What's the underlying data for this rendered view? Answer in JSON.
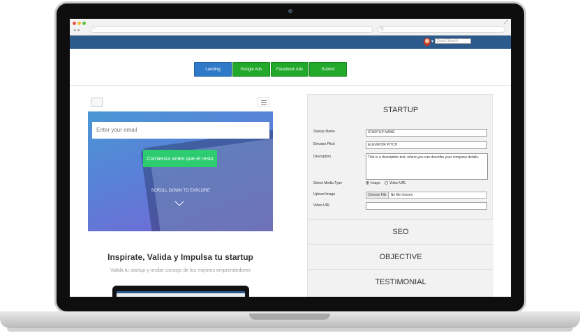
{
  "browser": {
    "address_placeholder": "+",
    "search_placeholder": "Q"
  },
  "appbar": {
    "quick_search_placeholder": "Quick Search"
  },
  "tabs": [
    {
      "label": "Landing"
    },
    {
      "label": "Google Ads"
    },
    {
      "label": "Facebook Ads"
    },
    {
      "label": "Submit"
    }
  ],
  "landing": {
    "email_placeholder": "Enter your email",
    "cta_label": "Comienza antes que el resto",
    "scroll_text": "SCROLL DOWN TO EXPLORE",
    "headline": "Inspirate, Valida y Impulsa tu startup",
    "subline": "Valida tu startup y recibe consejo de los mejores emprendedores"
  },
  "form": {
    "title": "STARTUP",
    "startup_name_label": "Startup Name",
    "startup_name_value": "STARTUP NAME",
    "pitch_label": "Elevator Pitch",
    "pitch_value": "ELEVATOR PITCH",
    "description_label": "Description",
    "description_value": "This is a description text, where you can describe your company details.",
    "media_type_label": "Select Media Type",
    "media_options": [
      "Image",
      "Video URL"
    ],
    "media_selected": "Image",
    "upload_label": "Upload Image",
    "choose_file_label": "Choose File",
    "no_file_text": "No file chosen",
    "video_url_label": "Video URL",
    "video_url_value": ""
  },
  "sections": [
    "SEO",
    "OBJECTIVE",
    "TESTIMONIAL"
  ],
  "colors": {
    "appbar": "#2d5a8c",
    "tab_blue": "#2e79c8",
    "tab_green": "#22a82a",
    "cta": "#2ecc71"
  }
}
